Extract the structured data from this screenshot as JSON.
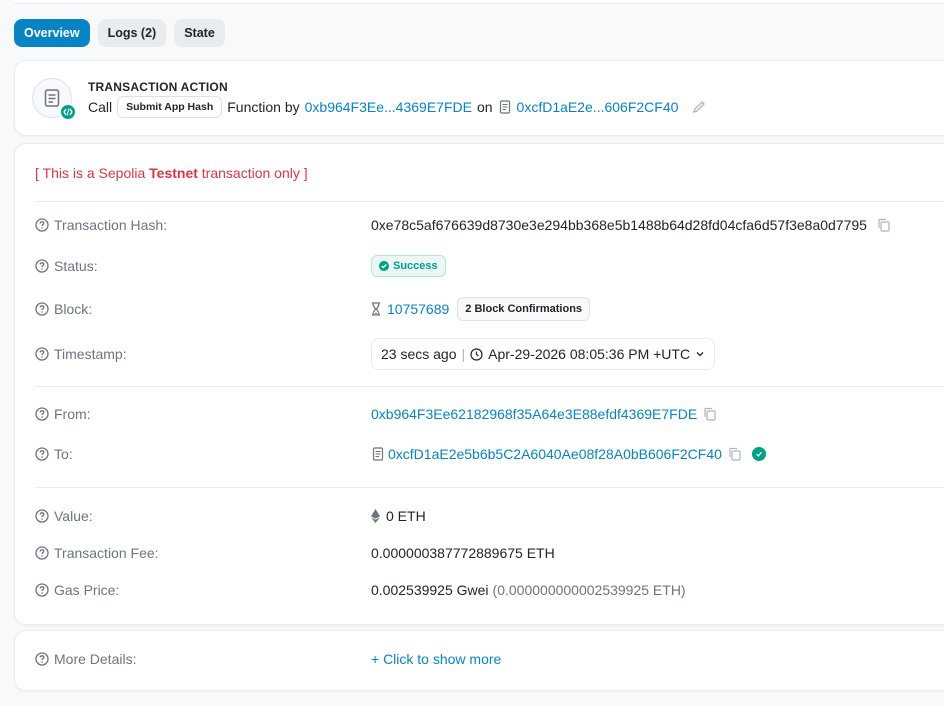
{
  "tabs": [
    {
      "label": "Overview",
      "active": true
    },
    {
      "label": "Logs (2)",
      "active": false
    },
    {
      "label": "State",
      "active": false
    }
  ],
  "action": {
    "title": "TRANSACTION ACTION",
    "call": "Call",
    "method": "Submit App Hash",
    "function_by": "Function by",
    "from_short": "0xb964F3Ee...4369E7FDE",
    "on": "on",
    "contract_short": "0xcfD1aE2e...606F2CF40"
  },
  "testnet_notice": {
    "prefix": "[ This is a Sepolia ",
    "bold": "Testnet",
    "suffix": " transaction only ]"
  },
  "fields": {
    "tx_hash": {
      "label": "Transaction Hash:",
      "value": "0xe78c5af676639d8730e3e294bb368e5b1488b64d28fd04cfa6d57f3e8a0d7795"
    },
    "status": {
      "label": "Status:",
      "value": "Success"
    },
    "block": {
      "label": "Block:",
      "value": "10757689",
      "confirmations": "2 Block Confirmations"
    },
    "timestamp": {
      "label": "Timestamp:",
      "ago": "23 secs ago",
      "sep": "|",
      "datetime": "Apr-29-2026 08:05:36 PM +UTC"
    },
    "from": {
      "label": "From:",
      "value": "0xb964F3Ee62182968f35A64e3E88efdf4369E7FDE"
    },
    "to": {
      "label": "To:",
      "value": "0xcfD1aE2e5b6b5C2A6040Ae08f28A0bB606F2CF40"
    },
    "value": {
      "label": "Value:",
      "value": "0 ETH"
    },
    "fee": {
      "label": "Transaction Fee:",
      "value": "0.000000387772889675 ETH"
    },
    "gas_price": {
      "label": "Gas Price:",
      "gwei": "0.002539925 Gwei",
      "eth": "(0.000000000002539925 ETH)"
    }
  },
  "more": {
    "label": "More Details:",
    "action": "+ Click to show more"
  },
  "colors": {
    "accent": "#0784c3",
    "success": "#00a186",
    "danger": "#dc3545"
  }
}
